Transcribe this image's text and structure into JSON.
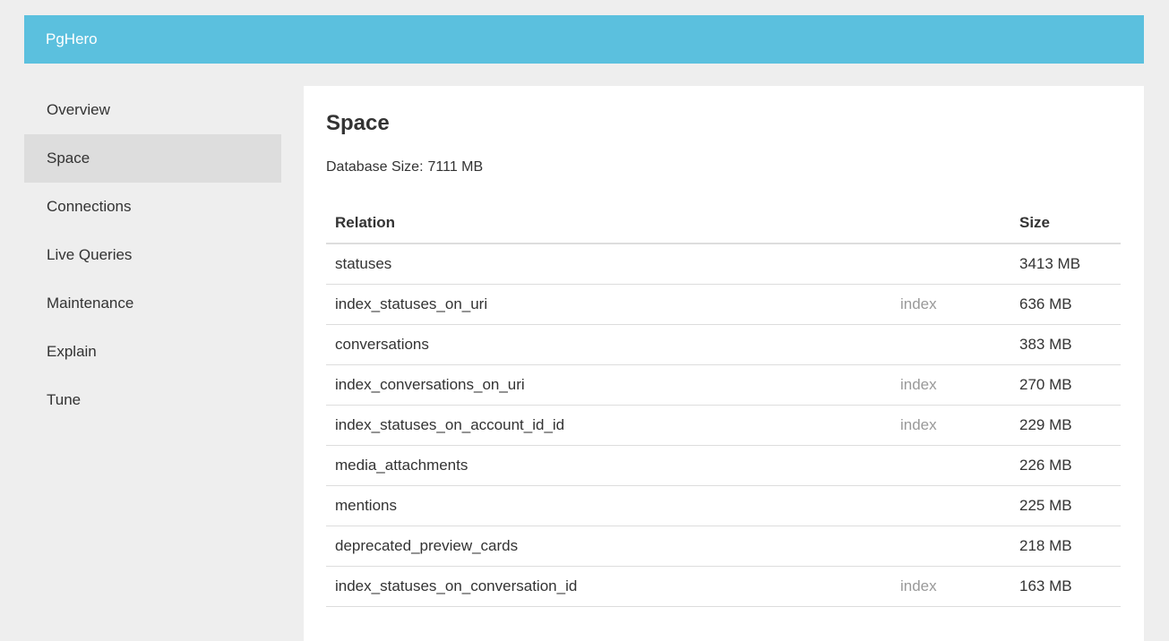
{
  "header": {
    "brand": "PgHero"
  },
  "sidebar": {
    "items": [
      {
        "label": "Overview",
        "active": false
      },
      {
        "label": "Space",
        "active": true
      },
      {
        "label": "Connections",
        "active": false
      },
      {
        "label": "Live Queries",
        "active": false
      },
      {
        "label": "Maintenance",
        "active": false
      },
      {
        "label": "Explain",
        "active": false
      },
      {
        "label": "Tune",
        "active": false
      }
    ]
  },
  "main": {
    "title": "Space",
    "database_size_label": "Database Size:",
    "database_size_value": "7111 MB",
    "table": {
      "columns": {
        "relation": "Relation",
        "type": "",
        "size": "Size"
      },
      "rows": [
        {
          "relation": "statuses",
          "type": "",
          "size": "3413 MB"
        },
        {
          "relation": "index_statuses_on_uri",
          "type": "index",
          "size": "636 MB"
        },
        {
          "relation": "conversations",
          "type": "",
          "size": "383 MB"
        },
        {
          "relation": "index_conversations_on_uri",
          "type": "index",
          "size": "270 MB"
        },
        {
          "relation": "index_statuses_on_account_id_id",
          "type": "index",
          "size": "229 MB"
        },
        {
          "relation": "media_attachments",
          "type": "",
          "size": "226 MB"
        },
        {
          "relation": "mentions",
          "type": "",
          "size": "225 MB"
        },
        {
          "relation": "deprecated_preview_cards",
          "type": "",
          "size": "218 MB"
        },
        {
          "relation": "index_statuses_on_conversation_id",
          "type": "index",
          "size": "163 MB"
        }
      ]
    }
  },
  "colors": {
    "header_bg": "#5bc0de",
    "active_nav_bg": "#dddddd",
    "page_bg": "#eeeeee",
    "muted_text": "#999999"
  }
}
